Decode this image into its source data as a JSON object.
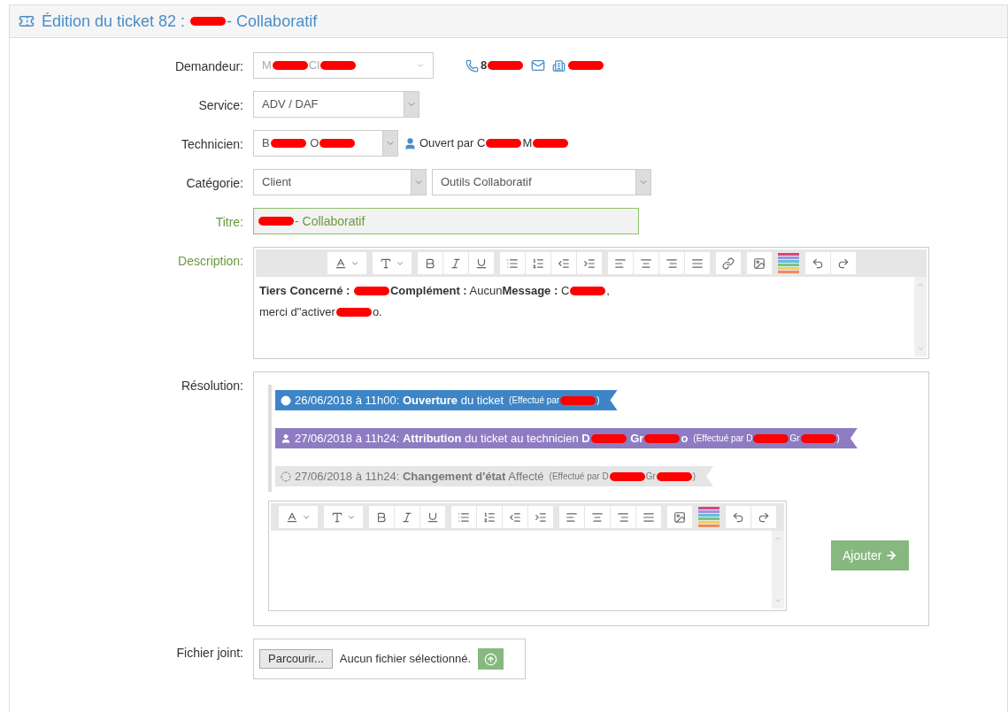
{
  "header": {
    "title": [
      {
        "kind": "text",
        "text": "Édition du ticket 82 : "
      },
      {
        "kind": "redacted"
      },
      {
        "kind": "text",
        "text": "- Collaboratif"
      }
    ]
  },
  "fields": [
    {
      "label": "Demandeur:",
      "kind": "combo",
      "value": [
        {
          "kind": "text",
          "text": "M"
        },
        {
          "kind": "redacted"
        },
        {
          "kind": "text",
          "text": "Cl"
        },
        {
          "kind": "redacted"
        }
      ],
      "contacts": [
        {
          "kind": "phone",
          "value": [
            {
              "kind": "text",
              "text": "8"
            },
            {
              "kind": "redacted"
            }
          ]
        },
        {
          "kind": "mail"
        },
        {
          "kind": "building",
          "value": [
            {
              "kind": "redacted"
            }
          ]
        }
      ]
    },
    {
      "label": "Service:",
      "kind": "select",
      "value": [
        {
          "kind": "text",
          "text": "ADV / DAF"
        }
      ]
    },
    {
      "label": "Technicien:",
      "kind": "select",
      "value": [
        {
          "kind": "text",
          "text": "B"
        },
        {
          "kind": "redacted"
        },
        {
          "kind": "text",
          "text": " O"
        },
        {
          "kind": "redacted"
        }
      ],
      "opened_by": [
        {
          "kind": "text",
          "text": "Ouvert par C"
        },
        {
          "kind": "redacted"
        },
        {
          "kind": "text",
          "text": "M"
        },
        {
          "kind": "redacted"
        }
      ]
    },
    {
      "label": "Catégorie:",
      "kind": "double",
      "value": [
        {
          "kind": "text",
          "text": "Client"
        }
      ],
      "second": "Outils Collaboratif"
    },
    {
      "label": "Titre:",
      "kind": "title",
      "value": [
        {
          "kind": "redacted"
        },
        {
          "kind": "text",
          "text": "- Collaboratif"
        }
      ]
    }
  ],
  "description": {
    "label": "Description:",
    "line1": [
      {
        "kind": "text",
        "text": "**Tiers Concerné :** "
      },
      {
        "kind": "redacted"
      },
      {
        "kind": "text",
        "text": "**Complément :** Aucun**Message :** C"
      },
      {
        "kind": "redacted"
      },
      {
        "kind": "text",
        "text": ","
      }
    ],
    "line2": [
      {
        "kind": "text",
        "text": "merci d''activer"
      },
      {
        "kind": "redacted"
      },
      {
        "kind": "text",
        "text": "o."
      }
    ]
  },
  "resolution": {
    "label": "Résolution:",
    "entries": [
      {
        "kind": "open",
        "color": "#3d85c6",
        "text": [
          {
            "kind": "text",
            "text": "26/06/2018 à 11h00: **Ouverture** du ticket"
          }
        ],
        "by": [
          {
            "kind": "text",
            "text": "(Effectué par"
          },
          {
            "kind": "redacted"
          },
          {
            "kind": "text",
            "text": ")"
          }
        ]
      },
      {
        "kind": "user",
        "color": "#8e7cc3",
        "text": [
          {
            "kind": "text",
            "text": "27/06/2018 à 11h24: **Attribution** du ticket au technicien **D**"
          },
          {
            "kind": "redacted"
          },
          {
            "kind": "text",
            "text": " **Gr**"
          },
          {
            "kind": "redacted"
          },
          {
            "kind": "text",
            "text": "**o**"
          }
        ],
        "by": [
          {
            "kind": "text",
            "text": "(Effectué par D"
          },
          {
            "kind": "redacted"
          },
          {
            "kind": "text",
            "text": "Gr"
          },
          {
            "kind": "redacted"
          },
          {
            "kind": "text",
            "text": ")"
          }
        ]
      },
      {
        "kind": "state",
        "color": "#e5e5e5",
        "text": [
          {
            "kind": "text",
            "text": "27/06/2018 à 11h24: **Changement d'état** Affecté"
          }
        ],
        "by": [
          {
            "kind": "text",
            "text": "(Effectué par D"
          },
          {
            "kind": "redacted"
          },
          {
            "kind": "text",
            "text": "Gr"
          },
          {
            "kind": "redacted"
          },
          {
            "kind": "text",
            "text": ")"
          }
        ]
      }
    ],
    "add_button": "Ajouter"
  },
  "attachment": {
    "label": "Fichier joint:",
    "browse": "Parcourir...",
    "status": "Aucun fichier sélectionné."
  }
}
